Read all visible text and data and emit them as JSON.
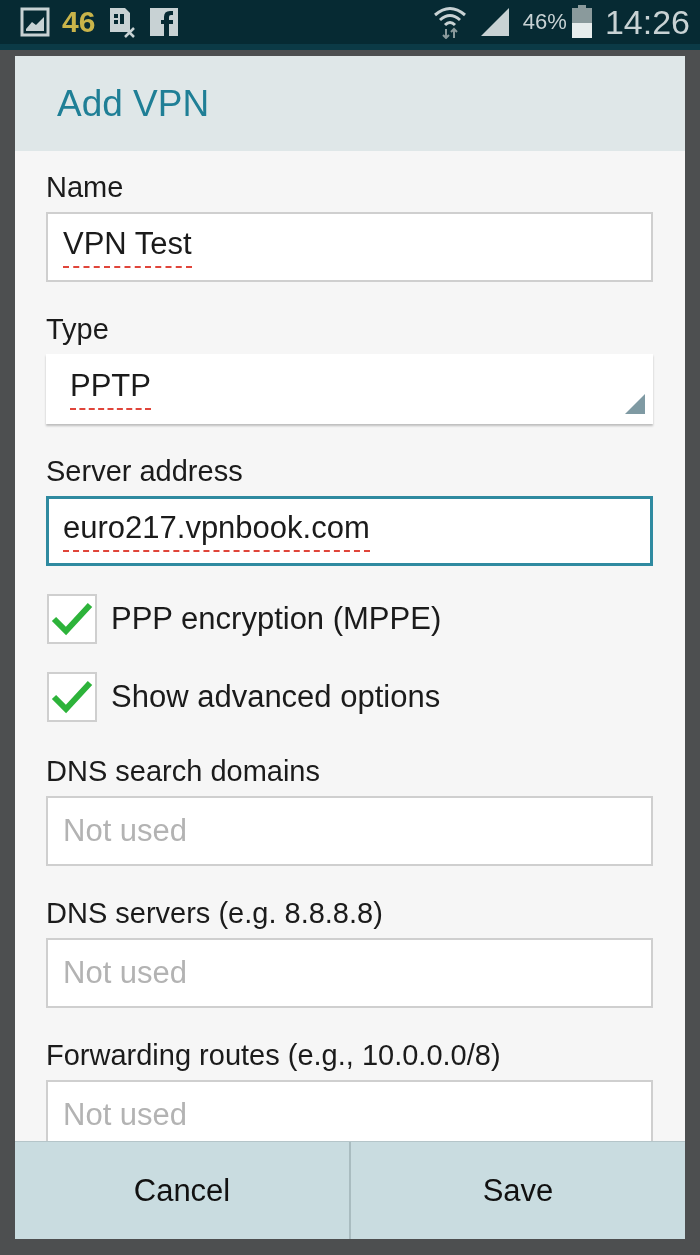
{
  "status_bar": {
    "notification_count": "46",
    "battery_percent": "46%",
    "time": "14:26"
  },
  "dialog": {
    "title": "Add VPN",
    "fields": [
      {
        "kind": "text",
        "label": "Name",
        "value": "VPN Test",
        "focused": false,
        "misspelled": true
      },
      {
        "kind": "dropdown",
        "label": "Type",
        "value": "PPTP",
        "misspelled": true
      },
      {
        "kind": "text",
        "label": "Server address",
        "value": "euro217.vpnbook.com",
        "focused": true,
        "misspelled": true
      },
      {
        "kind": "checkbox",
        "label": "PPP encryption (MPPE)",
        "checked": true
      },
      {
        "kind": "checkbox",
        "label": "Show advanced options",
        "checked": true
      },
      {
        "kind": "text",
        "label": "DNS search domains",
        "placeholder": "Not used",
        "focused": false
      },
      {
        "kind": "text",
        "label": "DNS servers (e.g. 8.8.8.8)",
        "placeholder": "Not used",
        "focused": false
      },
      {
        "kind": "text",
        "label": "Forwarding routes (e.g., 10.0.0.0/8)",
        "placeholder": "Not used",
        "focused": false
      }
    ],
    "buttons": [
      "Cancel",
      "Save"
    ]
  }
}
